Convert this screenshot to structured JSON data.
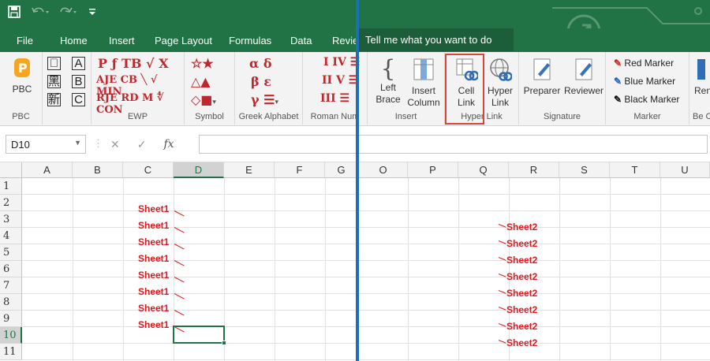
{
  "tabs": [
    "File",
    "Home",
    "Insert",
    "Page Layout",
    "Formulas",
    "Data",
    "Revie"
  ],
  "tell_me": "Tell me what you want to do",
  "ribbon": {
    "pbc": {
      "label": "PBC",
      "group": "PBC"
    },
    "ewp": {
      "group": "EWP",
      "k1": [
        "𥪡",
        "黑",
        "新"
      ],
      "k2": [
        "A",
        "B",
        "C"
      ]
    },
    "symbol": {
      "group": "Symbol"
    },
    "greek": {
      "group": "Greek Alphabet"
    },
    "roman": {
      "group": "Roman Num"
    },
    "insert": {
      "group": "Insert",
      "left_brace": [
        "Left",
        "Brace"
      ],
      "insert_column": [
        "Insert",
        "Column"
      ]
    },
    "hyperlink": {
      "group": "Hyper Link",
      "cell_link": [
        "Cell",
        "Link"
      ],
      "hyper_link": [
        "Hyper",
        "Link"
      ]
    },
    "signature": {
      "group": "Signature",
      "preparer": "Preparer",
      "reviewer": "Reviewer"
    },
    "marker": {
      "group": "Marker",
      "red": "Red Marker",
      "blue": "Blue Marker",
      "black": "Black Marker"
    },
    "more": {
      "label": "Ren",
      "group": "Be C"
    }
  },
  "name_box": "D10",
  "fx_label": "fx",
  "columns_left": [
    "A",
    "B",
    "C",
    "D",
    "E",
    "F",
    "G"
  ],
  "columns_right": [
    "O",
    "P",
    "Q",
    "R",
    "S",
    "T",
    "U"
  ],
  "rows": [
    "1",
    "2",
    "3",
    "4",
    "5",
    "6",
    "7",
    "8",
    "9",
    "10",
    "11"
  ],
  "sheet1_cells": [
    "Sheet1",
    "Sheet1",
    "Sheet1",
    "Sheet1",
    "Sheet1",
    "Sheet1",
    "Sheet1",
    "Sheet1"
  ],
  "sheet2_cells": [
    "Sheet2",
    "Sheet2",
    "Sheet2",
    "Sheet2",
    "Sheet2",
    "Sheet2",
    "Sheet2",
    "Sheet2"
  ],
  "colors": {
    "excel_green": "#217346",
    "link_red": "#e3171d",
    "splitter_blue": "#1b6fb7",
    "highlight": "#d9453b"
  }
}
